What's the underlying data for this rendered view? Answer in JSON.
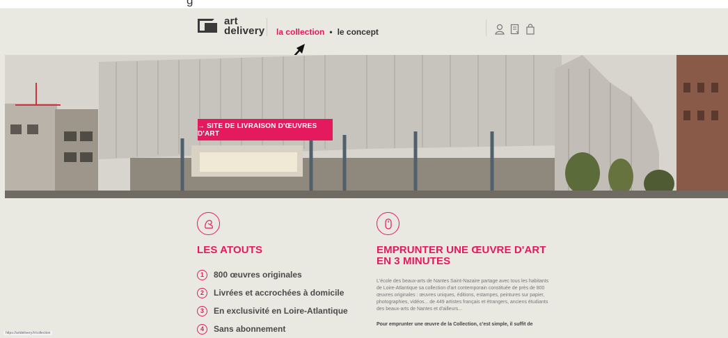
{
  "top_strip": {
    "cropped_text": "g"
  },
  "header": {
    "logo": {
      "line1": "art",
      "line2": "delivery"
    },
    "nav": {
      "active": "la collection",
      "separator": "•",
      "item2": "le concept"
    },
    "icons": [
      "user-icon",
      "document-icon",
      "bag-icon"
    ]
  },
  "hero": {
    "cta_label": "→ SITE DE LIVRAISON D'ŒUVRES D'ART"
  },
  "atouts": {
    "title": "LES ATOUTS",
    "items": [
      {
        "num": "1",
        "label": "800 œuvres originales"
      },
      {
        "num": "2",
        "label": "Livrées et accrochées à domicile"
      },
      {
        "num": "3",
        "label": "En exclusivité en Loire-Atlantique"
      },
      {
        "num": "4",
        "label": "Sans abonnement"
      }
    ]
  },
  "emprunter": {
    "title_line1": "EMPRUNTER UNE ŒUVRE D'ART",
    "title_line2": "EN 3 MINUTES",
    "paragraph": "L'école des beaux-arts de Nantes Saint-Nazaire partage avec tous les habitants de Loire-Atlantique sa collection d'art contemporain constituée de près de 800 œuvres originales : œuvres uniques, éditions, estampes, peintures sur papier, photographies, vidéos... de 449 artistes français et étrangers, anciens étudiants des beaux-arts de Nantes et d'ailleurs...",
    "paragraph2": "Pour emprunter une œuvre de la Collection, c'est simple, il suffit de"
  },
  "status_bar": {
    "url": "https://artdelivery.fr/collection"
  },
  "colors": {
    "accent": "#e5195e",
    "background": "#e9e8e1"
  }
}
